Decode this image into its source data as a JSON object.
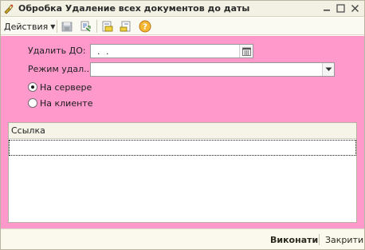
{
  "window": {
    "title": "Обробка  Удаление всех документов до даты"
  },
  "toolbar": {
    "actions_label": "Действия",
    "icons": [
      "disk-icon",
      "form-icon",
      "save-settings-icon",
      "restore-settings-icon",
      "help-icon"
    ]
  },
  "form": {
    "date_label": "Удалить ДО:",
    "date_value": ". .",
    "mode_label": "Режим удал...",
    "mode_value": "",
    "radio_server_label": "На сервере",
    "radio_client_label": "На клиенте",
    "selected_radio": "server",
    "background_color": "#ff99cc"
  },
  "table": {
    "columns": [
      "Ссылка"
    ],
    "rows": [
      ""
    ]
  },
  "footer": {
    "execute_label": "Виконати",
    "close_label": "Закрити"
  }
}
